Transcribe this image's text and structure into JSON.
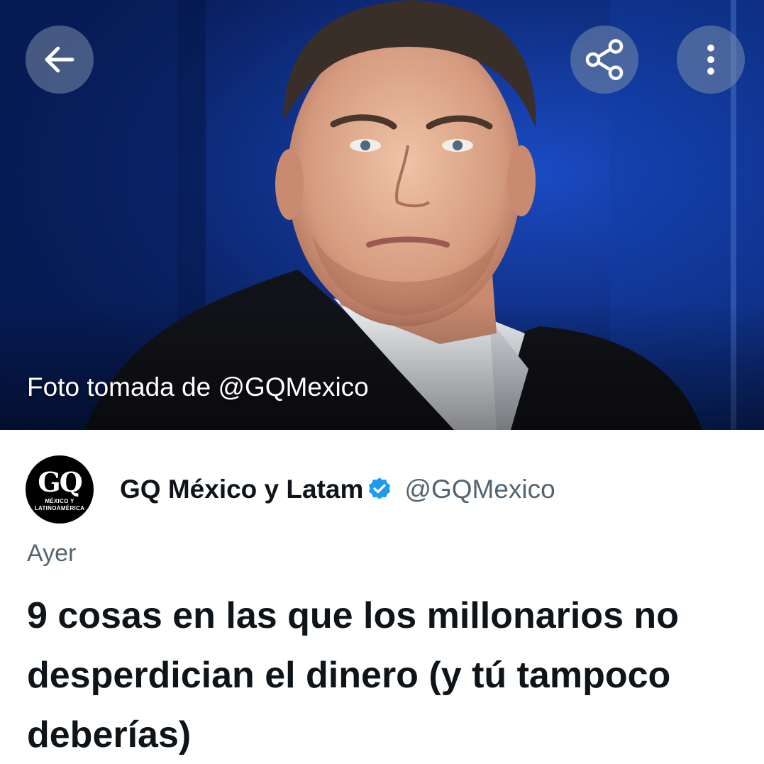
{
  "hero": {
    "caption": "Foto tomada de @GQMexico"
  },
  "toolbar": {
    "back_icon": "arrow-left-icon",
    "share_icon": "share-icon",
    "more_icon": "more-vertical-icon",
    "button_color": "#8a9ab4"
  },
  "author": {
    "avatar_logo": "GQ",
    "avatar_sub_line1": "MÉXICO Y",
    "avatar_sub_line2": "LATINOAMÉRICA",
    "name": "GQ México y Latam",
    "verified_icon": "verified-badge-icon",
    "verified_color": "#1d9bf0",
    "handle": "@GQMexico"
  },
  "post": {
    "timestamp": "Ayer",
    "headline": "9 cosas en las que los millonarios no desperdician el dinero (y tú tampoco deberías)"
  }
}
